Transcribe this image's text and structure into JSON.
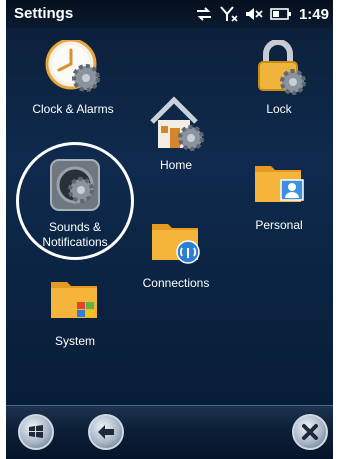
{
  "statusbar": {
    "title": "Settings",
    "time": "1:49"
  },
  "items": {
    "clock": {
      "label": "Clock & Alarms",
      "icon": "clock-gear-icon"
    },
    "lock": {
      "label": "Lock",
      "icon": "padlock-icon"
    },
    "home": {
      "label": "Home",
      "icon": "house-icon"
    },
    "sounds_line1": "Sounds &",
    "sounds_line2": "Notifications",
    "personal": {
      "label": "Personal",
      "icon": "contact-card-folder-icon"
    },
    "connections": {
      "label": "Connections",
      "icon": "wireless-folder-icon"
    },
    "system": {
      "label": "System",
      "icon": "windows-folder-icon"
    }
  },
  "bottombar": {
    "left_icon": "windows-start-icon",
    "back_icon": "back-arrow-icon",
    "close_icon": "close-icon"
  },
  "colors": {
    "background": "#0f2a4d",
    "folder": "#f2a72c",
    "text": "#ffffff"
  }
}
